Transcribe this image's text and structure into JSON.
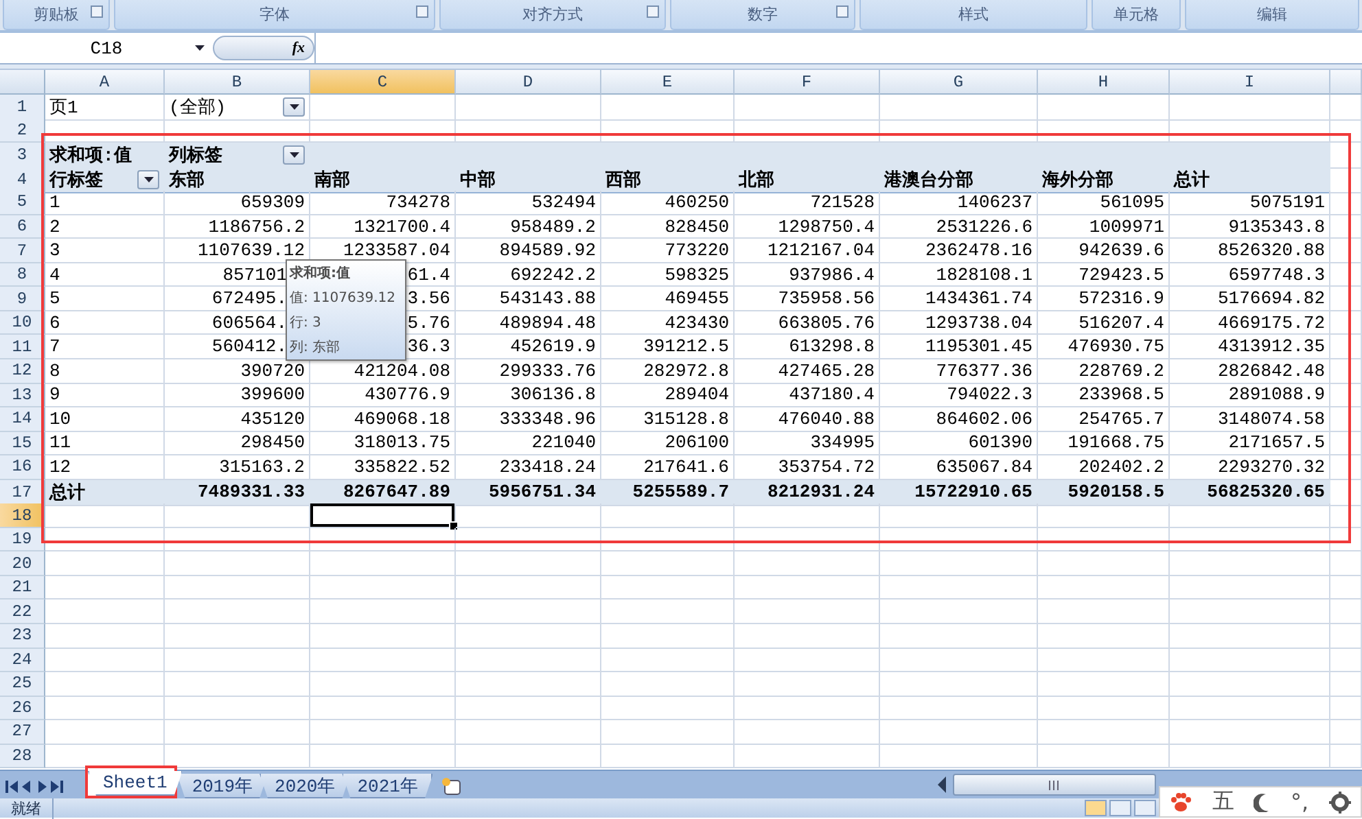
{
  "ribbon_groups": [
    {
      "label": "剪贴板",
      "launcher": true
    },
    {
      "label": "字体",
      "launcher": true
    },
    {
      "label": "对齐方式",
      "launcher": true
    },
    {
      "label": "数字",
      "launcher": true
    },
    {
      "label": "样式",
      "launcher": false
    },
    {
      "label": "单元格",
      "launcher": false
    },
    {
      "label": "编辑",
      "launcher": false
    }
  ],
  "formula_bar": {
    "name_box": "C18",
    "function_label": "fx"
  },
  "column_headers": [
    {
      "label": "A",
      "selected": false
    },
    {
      "label": "B",
      "selected": false
    },
    {
      "label": "C",
      "selected": true
    },
    {
      "label": "D",
      "selected": false
    },
    {
      "label": "E",
      "selected": false
    },
    {
      "label": "F",
      "selected": false
    },
    {
      "label": "G",
      "selected": false
    },
    {
      "label": "H",
      "selected": false
    },
    {
      "label": "I",
      "selected": false
    }
  ],
  "row_headers": [
    {
      "label": "1",
      "selected": false
    },
    {
      "label": "2",
      "selected": false
    },
    {
      "label": "3",
      "selected": false
    },
    {
      "label": "4",
      "selected": false
    },
    {
      "label": "5",
      "selected": false
    },
    {
      "label": "6",
      "selected": false
    },
    {
      "label": "7",
      "selected": false
    },
    {
      "label": "8",
      "selected": false
    },
    {
      "label": "9",
      "selected": false
    },
    {
      "label": "10",
      "selected": false
    },
    {
      "label": "11",
      "selected": false
    },
    {
      "label": "12",
      "selected": false
    },
    {
      "label": "13",
      "selected": false
    },
    {
      "label": "14",
      "selected": false
    },
    {
      "label": "15",
      "selected": false
    },
    {
      "label": "16",
      "selected": false
    },
    {
      "label": "17",
      "selected": false
    },
    {
      "label": "18",
      "selected": true
    },
    {
      "label": "19",
      "selected": false
    },
    {
      "label": "20",
      "selected": false
    },
    {
      "label": "21",
      "selected": false
    },
    {
      "label": "22",
      "selected": false
    },
    {
      "label": "23",
      "selected": false
    },
    {
      "label": "24",
      "selected": false
    },
    {
      "label": "25",
      "selected": false
    },
    {
      "label": "26",
      "selected": false
    },
    {
      "label": "27",
      "selected": false
    },
    {
      "label": "28",
      "selected": false
    }
  ],
  "pivot": {
    "highlighted": true,
    "page_field": {
      "label": "页1",
      "value": "(全部)"
    },
    "values_label": "求和项:值",
    "column_labels": "列标签",
    "row_labels": "行标签",
    "columns": [
      "东部",
      "南部",
      "中部",
      "西部",
      "北部",
      "港澳台分部",
      "海外分部",
      "总计"
    ],
    "rows": [
      {
        "label": "1",
        "clipped": false,
        "values": [
          "659309",
          "734278",
          "532494",
          "460250",
          "721528",
          "1406237",
          "561095",
          "5075191"
        ]
      },
      {
        "label": "2",
        "clipped": false,
        "values": [
          "1186756.2",
          "1321700.4",
          "958489.2",
          "828450",
          "1298750.4",
          "2531226.6",
          "1009971",
          "9135343.8"
        ]
      },
      {
        "label": "3",
        "clipped": false,
        "values": [
          "1107639.12",
          "1233587.04",
          "894589.92",
          "773220",
          "1212167.04",
          "2362478.16",
          "942639.6",
          "8526320.88"
        ]
      },
      {
        "label": "4",
        "clipped": true,
        "values": [
          "857101",
          "61.4",
          "692242.2",
          "598325",
          "937986.4",
          "1828108.1",
          "729423.5",
          "6597748.3"
        ]
      },
      {
        "label": "5",
        "clipped": true,
        "values": [
          "672495.",
          "3.56",
          "543143.88",
          "469455",
          "735958.56",
          "1434361.74",
          "572316.9",
          "5176694.82"
        ]
      },
      {
        "label": "6",
        "clipped": true,
        "values": [
          "606564.",
          "5.76",
          "489894.48",
          "423430",
          "663805.76",
          "1293738.04",
          "516207.4",
          "4669175.72"
        ]
      },
      {
        "label": "7",
        "clipped": true,
        "values": [
          "560412.",
          "36.3",
          "452619.9",
          "391212.5",
          "613298.8",
          "1195301.45",
          "476930.75",
          "4313912.35"
        ]
      },
      {
        "label": "8",
        "clipped": false,
        "values": [
          "390720",
          "421204.08",
          "299333.76",
          "282972.8",
          "427465.28",
          "776377.36",
          "228769.2",
          "2826842.48"
        ]
      },
      {
        "label": "9",
        "clipped": false,
        "values": [
          "399600",
          "430776.9",
          "306136.8",
          "289404",
          "437180.4",
          "794022.3",
          "233968.5",
          "2891088.9"
        ]
      },
      {
        "label": "10",
        "clipped": false,
        "values": [
          "435120",
          "469068.18",
          "333348.96",
          "315128.8",
          "476040.88",
          "864602.06",
          "254765.7",
          "3148074.58"
        ]
      },
      {
        "label": "11",
        "clipped": false,
        "values": [
          "298450",
          "318013.75",
          "221040",
          "206100",
          "334995",
          "601390",
          "191668.75",
          "2171657.5"
        ]
      },
      {
        "label": "12",
        "clipped": false,
        "values": [
          "315163.2",
          "335822.52",
          "233418.24",
          "217641.6",
          "353754.72",
          "635067.84",
          "202402.2",
          "2293270.32"
        ]
      }
    ],
    "total": {
      "label": "总计",
      "values": [
        "7489331.33",
        "8267647.89",
        "5956751.34",
        "5255589.7",
        "8212931.24",
        "15722910.65",
        "5920158.5",
        "56825320.65"
      ]
    }
  },
  "tooltip": {
    "title": "求和项:值",
    "lines": [
      "值: 1107639.12",
      "行: 3",
      "列: 东部"
    ]
  },
  "sheet_tabs": [
    {
      "label": "Sheet1",
      "selected": true,
      "highlighted": true
    },
    {
      "label": "2019年",
      "selected": false,
      "highlighted": false
    },
    {
      "label": "2020年",
      "selected": false,
      "highlighted": false
    },
    {
      "label": "2021年",
      "selected": false,
      "highlighted": false
    }
  ],
  "status_bar": {
    "text": "就绪"
  },
  "ime_bar": {
    "mode": "五",
    "punctuation": "°,"
  }
}
